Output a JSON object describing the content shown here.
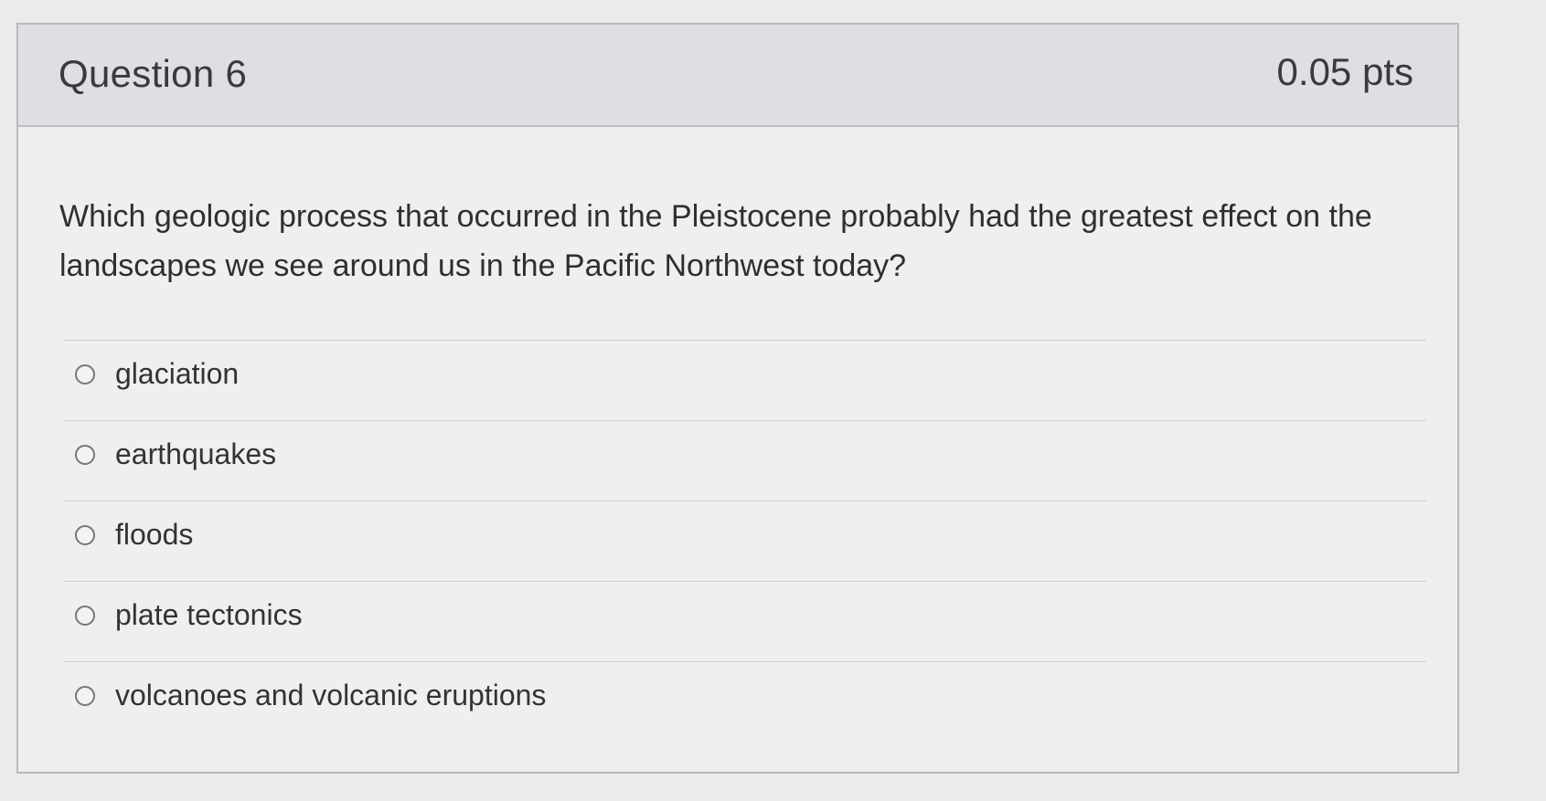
{
  "question": {
    "title": "Question 6",
    "points": "0.05 pts",
    "text": "Which geologic process that occurred in the Pleistocene probably had the greatest effect on the landscapes we see around us in the Pacific Northwest today?"
  },
  "answers": [
    {
      "label": "glaciation"
    },
    {
      "label": "earthquakes"
    },
    {
      "label": "floods"
    },
    {
      "label": "plate tectonics"
    },
    {
      "label": "volcanoes and volcanic eruptions"
    }
  ]
}
